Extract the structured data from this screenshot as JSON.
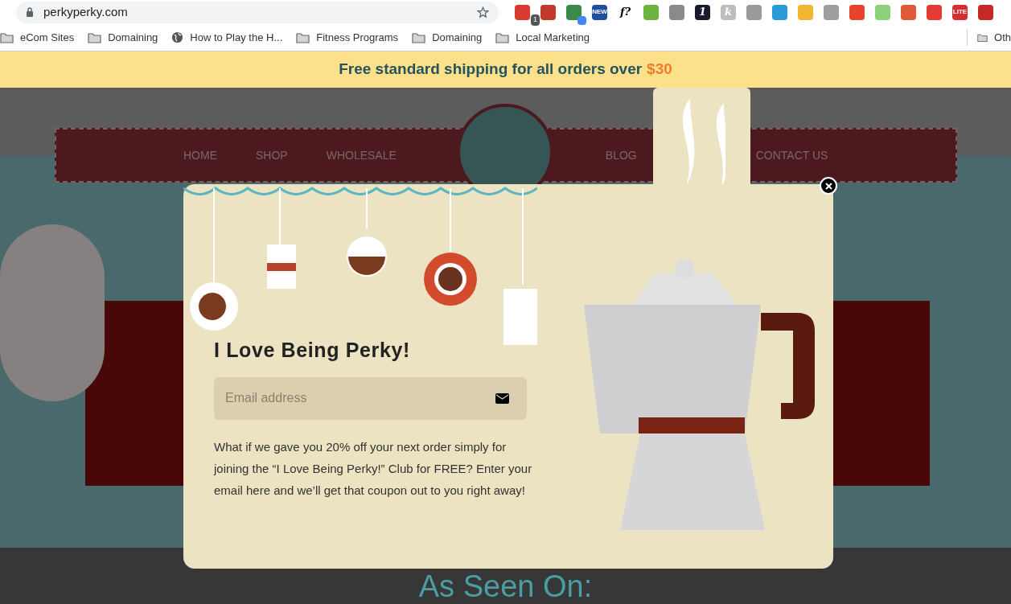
{
  "browser": {
    "url": "perkyperky.com",
    "extensions": [
      {
        "color": "#d93a30",
        "badge": "1"
      },
      {
        "color": "#c0392b"
      },
      {
        "color": "#3a8a4a",
        "badge_dot": true
      },
      {
        "color": "#1f4e9c",
        "label": "NEW"
      },
      {
        "color": "#ffffff",
        "label": "f?"
      },
      {
        "color": "#6db33f"
      },
      {
        "color": "#8a8a8a"
      },
      {
        "color": "#1a1a2e",
        "label": "1"
      },
      {
        "color": "#bdbdbd",
        "label": "k"
      },
      {
        "color": "#9a9a9a"
      },
      {
        "color": "#2a9ad8"
      },
      {
        "color": "#f2b632"
      },
      {
        "color": "#9e9e9e"
      },
      {
        "color": "#e8442c"
      },
      {
        "color": "#8cd07a"
      },
      {
        "color": "#e05a3a"
      },
      {
        "color": "#e53935"
      },
      {
        "color": "#d32f2f",
        "label": "LITE"
      },
      {
        "color": "#c62828"
      }
    ]
  },
  "bookmarks": [
    {
      "label": "eCom Sites",
      "kind": "folder"
    },
    {
      "label": "Domaining",
      "kind": "folder"
    },
    {
      "label": "How to Play the H...",
      "kind": "globe"
    },
    {
      "label": "Fitness Programs",
      "kind": "folder"
    },
    {
      "label": "Domaining",
      "kind": "folder"
    },
    {
      "label": "Local Marketing",
      "kind": "folder"
    }
  ],
  "other_bookmarks": "Oth",
  "announcement": {
    "text": "Free standard shipping for all orders over",
    "amount": "$30"
  },
  "nav": {
    "left": [
      "HOME",
      "SHOP",
      "WHOLESALE"
    ],
    "right": [
      "BLOG",
      "CONTACT US"
    ]
  },
  "section_heading": "As Seen On:",
  "popup": {
    "title": "I Love Being Perky!",
    "email_placeholder": "Email address",
    "body": "What if we gave you 20% off your next order simply for joining the “I Love Being Perky!” Club for FREE? Enter your email here and we’ll get that coupon out to you right away!"
  }
}
